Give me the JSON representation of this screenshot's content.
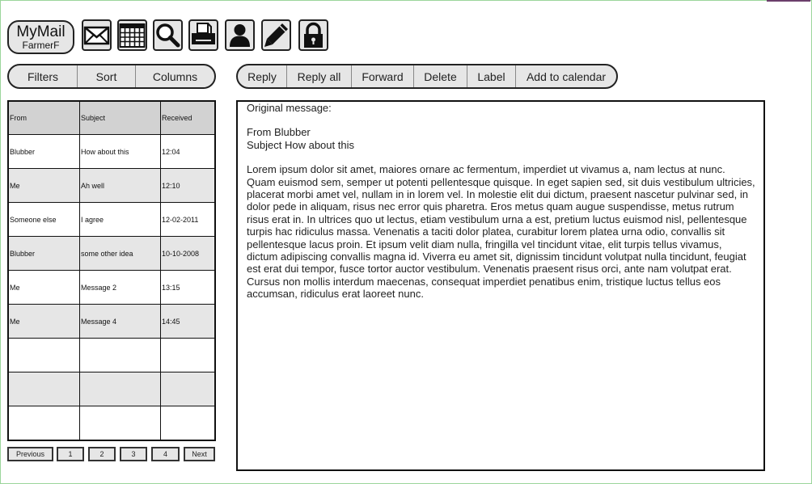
{
  "app": {
    "name": "MyMail",
    "user": "FarmerF"
  },
  "toolbar_icons": [
    "mail-icon",
    "calendar-icon",
    "search-icon",
    "print-icon",
    "contacts-icon",
    "compose-icon",
    "lock-icon"
  ],
  "list_controls": [
    "Filters",
    "Sort",
    "Columns"
  ],
  "message_actions": [
    "Reply",
    "Reply all",
    "Forward",
    "Delete",
    "Label",
    "Add to calendar"
  ],
  "table": {
    "headers": [
      "From",
      "Subject",
      "Received"
    ],
    "rows": [
      [
        "Blubber",
        "How about this",
        "12:04"
      ],
      [
        "Me",
        "Ah well",
        "12:10"
      ],
      [
        "Someone else",
        "I agree",
        "12-02-2011"
      ],
      [
        "Blubber",
        "some other idea",
        "10-10-2008"
      ],
      [
        "Me",
        "Message 2",
        "13:15"
      ],
      [
        "Me",
        "Message 4",
        "14:45"
      ],
      [
        "",
        "",
        ""
      ],
      [
        "",
        "",
        ""
      ],
      [
        "",
        "",
        ""
      ]
    ]
  },
  "pagination": {
    "previous": "Previous",
    "pages": [
      "1",
      "2",
      "3",
      "4"
    ],
    "next": "Next"
  },
  "message": {
    "header": "Original message:",
    "from": "From Blubber",
    "subject": "Subject How about this",
    "body": "Lorem ipsum dolor sit amet, maiores ornare ac fermentum, imperdiet ut vivamus a, nam lectus at nunc. Quam euismod sem, semper ut potenti pellentesque quisque. In eget sapien sed, sit duis vestibulum ultricies, placerat morbi amet vel, nullam in in lorem vel. In molestie elit dui dictum, praesent nascetur pulvinar sed, in dolor pede in aliquam, risus nec error quis pharetra. Eros metus quam augue suspendisse, metus rutrum risus erat in.  In ultrices quo ut lectus, etiam vestibulum urna a est, pretium luctus euismod nisl, pellentesque turpis hac ridiculus massa. Venenatis a taciti dolor platea, curabitur lorem platea urna odio, convallis sit pellentesque lacus proin. Et ipsum velit diam nulla, fringilla vel tincidunt vitae, elit turpis tellus vivamus, dictum adipiscing convallis magna id. Viverra eu amet sit, dignissim tincidunt volutpat nulla tincidunt, feugiat est erat dui tempor, fusce tortor auctor vestibulum. Venenatis praesent risus orci, ante nam volutpat erat. Cursus non mollis interdum maecenas, consequat imperdiet penatibus enim, tristique luctus tellus eos accumsan, ridiculus erat laoreet nunc."
  }
}
